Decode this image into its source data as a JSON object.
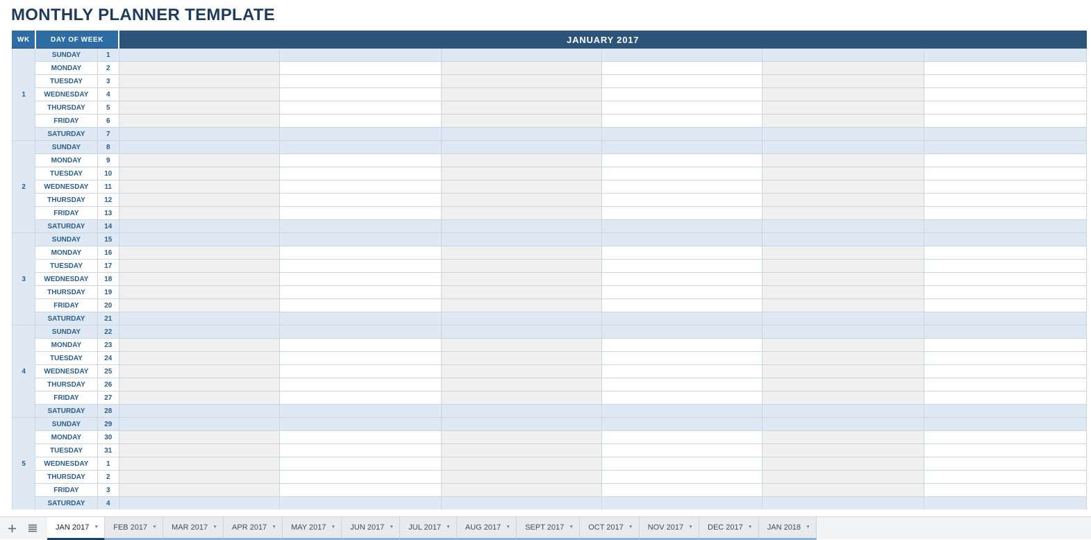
{
  "page": {
    "title": "MONTHLY PLANNER TEMPLATE",
    "title_color": "#1f3b5c"
  },
  "table": {
    "headers": {
      "wk": "WK",
      "day_of_week": "DAY OF WEEK",
      "month": "JANUARY 2017"
    },
    "colors": {
      "header_blue": "#2e6da4",
      "month_navy": "#2c5479",
      "weekend_fill": "#dfe9f3",
      "column_shade": "#f0f0f0",
      "text_blue": "#2d5d88"
    },
    "entry_columns": 6,
    "weeks": [
      {
        "wk": "1",
        "days": [
          {
            "day": "SUNDAY",
            "date": "1",
            "weekend": true
          },
          {
            "day": "MONDAY",
            "date": "2",
            "weekend": false
          },
          {
            "day": "TUESDAY",
            "date": "3",
            "weekend": false
          },
          {
            "day": "WEDNESDAY",
            "date": "4",
            "weekend": false
          },
          {
            "day": "THURSDAY",
            "date": "5",
            "weekend": false
          },
          {
            "day": "FRIDAY",
            "date": "6",
            "weekend": false
          },
          {
            "day": "SATURDAY",
            "date": "7",
            "weekend": true
          }
        ]
      },
      {
        "wk": "2",
        "days": [
          {
            "day": "SUNDAY",
            "date": "8",
            "weekend": true
          },
          {
            "day": "MONDAY",
            "date": "9",
            "weekend": false
          },
          {
            "day": "TUESDAY",
            "date": "10",
            "weekend": false
          },
          {
            "day": "WEDNESDAY",
            "date": "11",
            "weekend": false
          },
          {
            "day": "THURSDAY",
            "date": "12",
            "weekend": false
          },
          {
            "day": "FRIDAY",
            "date": "13",
            "weekend": false
          },
          {
            "day": "SATURDAY",
            "date": "14",
            "weekend": true
          }
        ]
      },
      {
        "wk": "3",
        "days": [
          {
            "day": "SUNDAY",
            "date": "15",
            "weekend": true
          },
          {
            "day": "MONDAY",
            "date": "16",
            "weekend": false
          },
          {
            "day": "TUESDAY",
            "date": "17",
            "weekend": false
          },
          {
            "day": "WEDNESDAY",
            "date": "18",
            "weekend": false
          },
          {
            "day": "THURSDAY",
            "date": "19",
            "weekend": false
          },
          {
            "day": "FRIDAY",
            "date": "20",
            "weekend": false
          },
          {
            "day": "SATURDAY",
            "date": "21",
            "weekend": true
          }
        ]
      },
      {
        "wk": "4",
        "days": [
          {
            "day": "SUNDAY",
            "date": "22",
            "weekend": true
          },
          {
            "day": "MONDAY",
            "date": "23",
            "weekend": false
          },
          {
            "day": "TUESDAY",
            "date": "24",
            "weekend": false
          },
          {
            "day": "WEDNESDAY",
            "date": "25",
            "weekend": false
          },
          {
            "day": "THURSDAY",
            "date": "26",
            "weekend": false
          },
          {
            "day": "FRIDAY",
            "date": "27",
            "weekend": false
          },
          {
            "day": "SATURDAY",
            "date": "28",
            "weekend": true
          }
        ]
      },
      {
        "wk": "5",
        "days": [
          {
            "day": "SUNDAY",
            "date": "29",
            "weekend": true
          },
          {
            "day": "MONDAY",
            "date": "30",
            "weekend": false
          },
          {
            "day": "TUESDAY",
            "date": "31",
            "weekend": false
          },
          {
            "day": "WEDNESDAY",
            "date": "1",
            "weekend": false
          },
          {
            "day": "THURSDAY",
            "date": "2",
            "weekend": false
          },
          {
            "day": "FRIDAY",
            "date": "3",
            "weekend": false
          },
          {
            "day": "SATURDAY",
            "date": "4",
            "weekend": true
          }
        ]
      }
    ]
  },
  "sheet_bar": {
    "add_sheet_icon": "plus-icon",
    "all_sheets_icon": "hamburger-icon",
    "active_tab": "JAN 2017",
    "tabs": [
      {
        "label": "JAN 2017",
        "active": true
      },
      {
        "label": "FEB 2017",
        "active": false
      },
      {
        "label": "MAR 2017",
        "active": false
      },
      {
        "label": "APR 2017",
        "active": false
      },
      {
        "label": "MAY 2017",
        "active": false
      },
      {
        "label": "JUN 2017",
        "active": false
      },
      {
        "label": "JUL 2017",
        "active": false
      },
      {
        "label": "AUG 2017",
        "active": false
      },
      {
        "label": "SEPT 2017",
        "active": false
      },
      {
        "label": "OCT 2017",
        "active": false
      },
      {
        "label": "NOV 2017",
        "active": false
      },
      {
        "label": "DEC 2017",
        "active": false
      },
      {
        "label": "JAN 2018",
        "active": false
      }
    ],
    "tab_caret_icon": "chevron-down-icon"
  }
}
